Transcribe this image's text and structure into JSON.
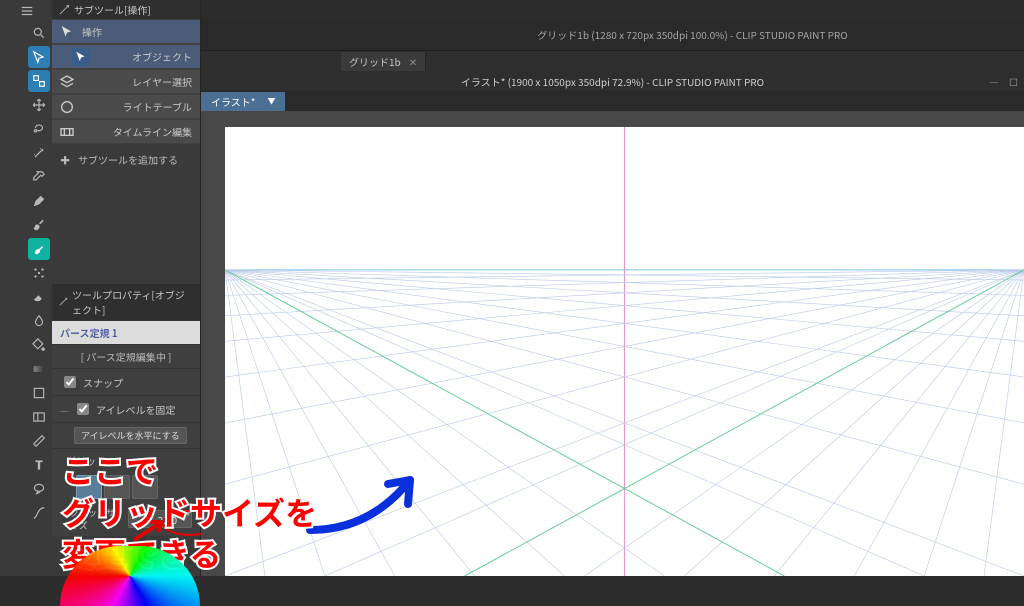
{
  "panel_headers": {
    "subtool": "サブツール[操作]",
    "tool_property": "ツールプロパティ[オブジェクト]"
  },
  "subtools": [
    {
      "label": "操作",
      "sel": true
    },
    {
      "label": "オブジェクト",
      "sel": true,
      "indent": true
    },
    {
      "label": "レイヤー選択"
    },
    {
      "label": "ライトテーブル"
    },
    {
      "label": "タイムライン編集"
    }
  ],
  "add_subtool": "サブツールを追加する",
  "prop": {
    "perspective_ruler": "パース定規 1",
    "editing_label": "[ パース定規編集中 ]",
    "snap": "スナップ",
    "fix_eyelevel": "アイレベルを固定",
    "eyelevel_horizontal": "アイレベルを水平にする",
    "grid_label": "グリッド",
    "grid_size_label": "グリッドサイズ",
    "grid_size_value": "25.0"
  },
  "windows": {
    "back_title": "グリッド1b (1280 x 720px 350dpi 100.0%)  - CLIP STUDIO PAINT PRO",
    "back_tab": "グリッド1b",
    "front_title": "イラスト* (1900 x 1050px 350dpi 72.9%)  - CLIP STUDIO PAINT PRO",
    "front_tab": "イラスト*"
  },
  "annotations": {
    "line1": "ここで",
    "line2": "グリッドサイズを",
    "line3": "変更できる"
  }
}
